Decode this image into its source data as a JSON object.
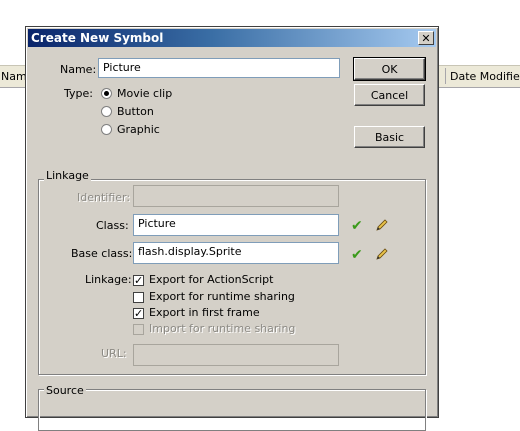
{
  "background": {
    "columns": [
      "Name",
      "Date Modified"
    ]
  },
  "dialog": {
    "title": "Create New Symbol",
    "name_label": "Name:",
    "name_value": "Picture",
    "type_label": "Type:",
    "type_options": [
      "Movie clip",
      "Button",
      "Graphic"
    ],
    "type_selected": "Movie clip",
    "buttons": {
      "ok": "OK",
      "cancel": "Cancel",
      "basic": "Basic"
    },
    "linkage_group": {
      "title": "Linkage",
      "identifier_label": "Identifier:",
      "identifier_value": "",
      "class_label": "Class:",
      "class_value": "Picture",
      "base_class_label": "Base class:",
      "base_class_value": "flash.display.Sprite",
      "linkage_label": "Linkage:",
      "checkboxes": [
        {
          "label": "Export for ActionScript",
          "checked": true,
          "enabled": true
        },
        {
          "label": "Export for runtime sharing",
          "checked": false,
          "enabled": true
        },
        {
          "label": "Export in first frame",
          "checked": true,
          "enabled": true
        },
        {
          "label": "Import for runtime sharing",
          "checked": false,
          "enabled": false
        }
      ],
      "url_label": "URL:",
      "url_value": ""
    },
    "source_group": {
      "title": "Source"
    },
    "icons": {
      "validate": "checkmark-icon",
      "edit": "pencil-icon"
    }
  }
}
